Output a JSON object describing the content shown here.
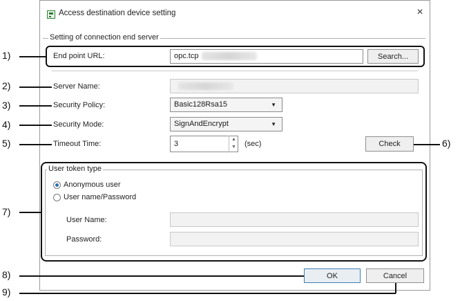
{
  "window": {
    "title": "Access destination device setting",
    "close_icon": "close-icon"
  },
  "connection": {
    "legend": "Setting of connection end server",
    "endpoint_label": "End point URL:",
    "endpoint_value": "opc.tcp",
    "search_label": "Search...",
    "server_name_label": "Server Name:",
    "security_policy_label": "Security Policy:",
    "security_policy_value": "Basic128Rsa15",
    "security_mode_label": "Security Mode:",
    "security_mode_value": "SignAndEncrypt",
    "timeout_label": "Timeout Time:",
    "timeout_value": "3",
    "timeout_unit": "(sec)",
    "check_label": "Check"
  },
  "user_token": {
    "legend": "User token type",
    "anonymous_label": "Anonymous user",
    "anonymous_selected": true,
    "userpass_label": "User name/Password",
    "user_name_label": "User Name:",
    "password_label": "Password:"
  },
  "footer": {
    "ok_label": "OK",
    "cancel_label": "Cancel"
  },
  "callouts": [
    "1)",
    "2)",
    "3)",
    "4)",
    "5)",
    "6)",
    "7)",
    "8)",
    "9)"
  ]
}
